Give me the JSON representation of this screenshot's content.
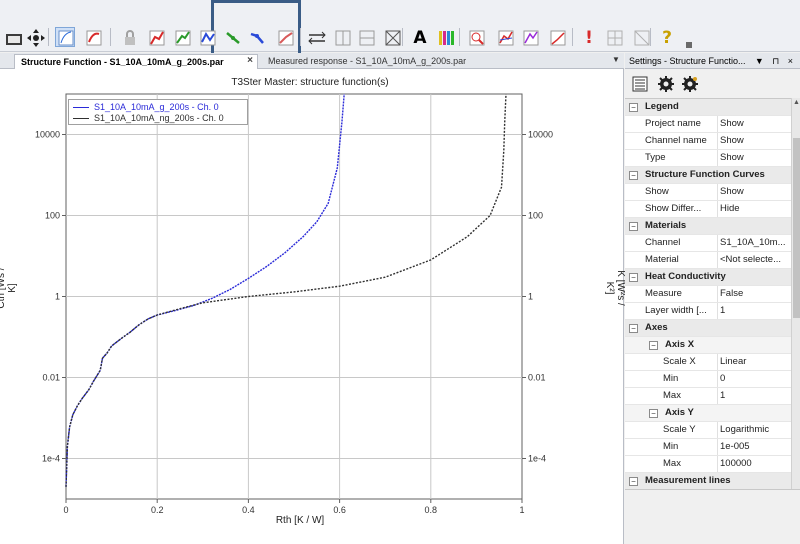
{
  "toolbar": {
    "buttons": [
      {
        "icon": "open-folder-icon"
      },
      {
        "icon": "pan-move-icon"
      },
      {
        "icon": "cursor-chart-icon"
      },
      {
        "icon": "reload-red-icon"
      },
      {
        "icon": "lock-icon"
      },
      {
        "icon": "red-curve-icon"
      },
      {
        "icon": "green-curve-icon"
      },
      {
        "icon": "blue-curve-icon"
      },
      {
        "icon": "green-step-icon"
      },
      {
        "icon": "blue-step-icon"
      },
      {
        "icon": "red-step-icon"
      },
      {
        "icon": "range-arrows-icon"
      },
      {
        "icon": "grid-vertical-icon"
      },
      {
        "icon": "grid-horizontal-icon"
      },
      {
        "icon": "crossbox-icon"
      },
      {
        "icon": "text-font-icon"
      },
      {
        "icon": "color-bars-icon"
      },
      {
        "icon": "zoom-fit-icon"
      },
      {
        "icon": "curves-red-icon"
      },
      {
        "icon": "curves-purple-icon"
      },
      {
        "icon": "curve-green-icon"
      },
      {
        "icon": "alert-icon"
      },
      {
        "icon": "disabled-grid-icon"
      },
      {
        "icon": "disabled-box-icon"
      },
      {
        "icon": "help-icon"
      }
    ],
    "text_button_label": "A",
    "alert_label": "!",
    "help_label": "?"
  },
  "tabs": {
    "active_label": "Structure Function - S1_10A_10mA_g_200s.par",
    "inactive_label": "Measured response - S1_10A_10mA_g_200s.par",
    "close_label": "×",
    "menu_label": "▼"
  },
  "chart": {
    "title": "T3Ster Master: structure function(s)",
    "xlabel": "Rth  [K / W]",
    "ylabel_left": "Cth  [Ws / K]",
    "ylabel_right": "K  [W²s / K²]",
    "legend": [
      {
        "name": "S1_10A_10mA_g_200s - Ch. 0",
        "color": "#2a2ad8"
      },
      {
        "name": "S1_10A_10mA_ng_200s - Ch. 0",
        "color": "#303030"
      }
    ]
  },
  "chart_data": {
    "type": "line",
    "title": "T3Ster Master: structure function(s)",
    "xlabel": "Rth  [K / W]",
    "ylabel": "Cth  [Ws / K]",
    "xlim": [
      0,
      1
    ],
    "ylim": [
      1e-05,
      100000
    ],
    "y_scale": "log",
    "x_ticks": [
      "0",
      "0.2",
      "0.4",
      "0.6",
      "0.8",
      "1"
    ],
    "y_ticks_left": [
      "1e-4",
      "0.01",
      "1",
      "100",
      "10000"
    ],
    "y_ticks_right": [
      "1e-4",
      "0.01",
      "1",
      "100",
      "10000"
    ],
    "grid": true,
    "legend_position": "top-left",
    "series": [
      {
        "name": "S1_10A_10mA_g_200s - Ch. 0",
        "color": "#2a2ad8",
        "points": [
          [
            0,
            2e-05
          ],
          [
            0.003,
            0.0002
          ],
          [
            0.008,
            0.0006
          ],
          [
            0.015,
            0.0012
          ],
          [
            0.025,
            0.002
          ],
          [
            0.035,
            0.003
          ],
          [
            0.05,
            0.005
          ],
          [
            0.06,
            0.008
          ],
          [
            0.075,
            0.015
          ],
          [
            0.08,
            0.03
          ],
          [
            0.09,
            0.04
          ],
          [
            0.1,
            0.06
          ],
          [
            0.12,
            0.09
          ],
          [
            0.14,
            0.13
          ],
          [
            0.16,
            0.2
          ],
          [
            0.18,
            0.28
          ],
          [
            0.2,
            0.35
          ],
          [
            0.24,
            0.45
          ],
          [
            0.28,
            0.6
          ],
          [
            0.32,
            0.9
          ],
          [
            0.36,
            1.5
          ],
          [
            0.4,
            2.8
          ],
          [
            0.44,
            5.5
          ],
          [
            0.48,
            12
          ],
          [
            0.52,
            30
          ],
          [
            0.55,
            70
          ],
          [
            0.575,
            200
          ],
          [
            0.595,
            1500
          ],
          [
            0.605,
            20000
          ],
          [
            0.61,
            100000
          ]
        ]
      },
      {
        "name": "S1_10A_10mA_ng_200s - Ch. 0",
        "color": "#303030",
        "points": [
          [
            0,
            2e-05
          ],
          [
            0.003,
            0.0002
          ],
          [
            0.008,
            0.0006
          ],
          [
            0.015,
            0.0012
          ],
          [
            0.025,
            0.002
          ],
          [
            0.035,
            0.003
          ],
          [
            0.05,
            0.005
          ],
          [
            0.06,
            0.008
          ],
          [
            0.075,
            0.015
          ],
          [
            0.08,
            0.03
          ],
          [
            0.09,
            0.04
          ],
          [
            0.1,
            0.06
          ],
          [
            0.12,
            0.09
          ],
          [
            0.14,
            0.13
          ],
          [
            0.16,
            0.2
          ],
          [
            0.18,
            0.28
          ],
          [
            0.2,
            0.35
          ],
          [
            0.25,
            0.5
          ],
          [
            0.3,
            0.7
          ],
          [
            0.4,
            1
          ],
          [
            0.5,
            1.3
          ],
          [
            0.6,
            1.8
          ],
          [
            0.7,
            3
          ],
          [
            0.8,
            8
          ],
          [
            0.88,
            30
          ],
          [
            0.93,
            100
          ],
          [
            0.955,
            500
          ],
          [
            0.96,
            4000
          ],
          [
            0.962,
            20000
          ],
          [
            0.965,
            100000
          ]
        ]
      }
    ]
  },
  "panel": {
    "title": "Settings - Structure Functio...",
    "header_buttons": "▼ ⊓ ×",
    "tools": [
      {
        "icon": "categorized-view-icon"
      },
      {
        "icon": "gear-settings-icon"
      },
      {
        "icon": "gear-advanced-icon"
      }
    ],
    "rows": [
      {
        "type": "cat",
        "name": "Legend",
        "expander": "⊟"
      },
      {
        "type": "item",
        "name": "Project name",
        "value": "Show"
      },
      {
        "type": "item",
        "name": "Channel name",
        "value": "Show"
      },
      {
        "type": "item",
        "name": "Type",
        "value": "Show"
      },
      {
        "type": "cat",
        "name": "Structure Function Curves",
        "expander": "⊟"
      },
      {
        "type": "item",
        "name": "Show",
        "value": "Show"
      },
      {
        "type": "item",
        "name": "Show Differ...",
        "value": "Hide"
      },
      {
        "type": "cat",
        "name": "Materials",
        "expander": "⊟"
      },
      {
        "type": "item",
        "name": "Channel",
        "value": "S1_10A_10m..."
      },
      {
        "type": "item",
        "name": "Material",
        "value": "<Not selecte..."
      },
      {
        "type": "cat",
        "name": "Heat Conductivity",
        "expander": "⊟"
      },
      {
        "type": "item",
        "name": "Measure",
        "value": "False"
      },
      {
        "type": "item",
        "name": "Layer width [...",
        "value": "1"
      },
      {
        "type": "cat",
        "name": "Axes",
        "expander": "⊟"
      },
      {
        "type": "sub",
        "name": "Axis X",
        "expander": "⊟"
      },
      {
        "type": "item2",
        "name": "Scale X",
        "value": "Linear"
      },
      {
        "type": "item2",
        "name": "Min",
        "value": "0"
      },
      {
        "type": "item2",
        "name": "Max",
        "value": "1"
      },
      {
        "type": "sub",
        "name": "Axis Y",
        "expander": "⊟"
      },
      {
        "type": "item2",
        "name": "Scale Y",
        "value": "Logarithmic"
      },
      {
        "type": "item2",
        "name": "Min",
        "value": "1e-005"
      },
      {
        "type": "item2",
        "name": "Max",
        "value": "100000"
      },
      {
        "type": "cat",
        "name": "Measurement lines",
        "expander": "⊟"
      }
    ]
  }
}
